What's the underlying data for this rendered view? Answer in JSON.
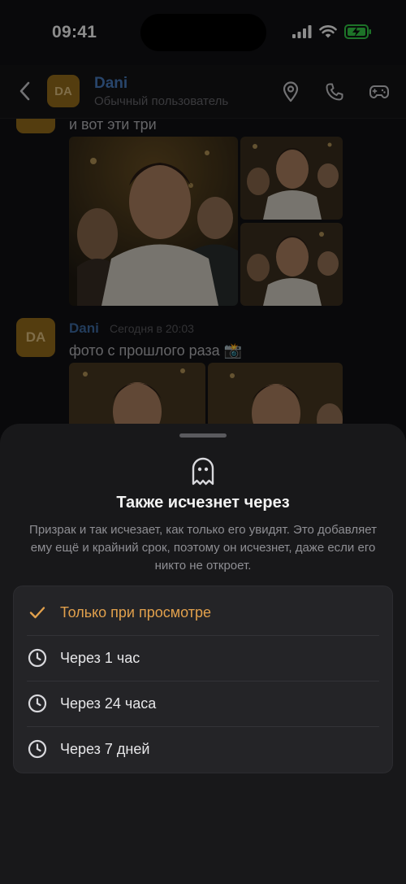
{
  "status_bar": {
    "time": "09:41"
  },
  "header": {
    "avatar_initials": "DA",
    "name": "Dani",
    "status": "Обычный пользователь",
    "icons": [
      "chevron-left-icon",
      "location-pin-icon",
      "phone-icon",
      "gamepad-icon"
    ]
  },
  "messages": {
    "first_text": "и вот эти три",
    "second": {
      "avatar_initials": "DA",
      "name": "Dani",
      "time": "Сегодня в 20:03",
      "text": "фото с прошлого раза 📸"
    }
  },
  "sheet": {
    "title": "Также исчезнет через",
    "description": "Призрак и так исчезает, как только его увидят. Это добавляет ему ещё и крайний срок, поэтому он исчезнет, даже если его никто не откроет.",
    "options": [
      {
        "label": "Только при просмотре",
        "icon": "checkmark-icon",
        "selected": true
      },
      {
        "label": "Через 1 час",
        "icon": "clock-icon",
        "selected": false
      },
      {
        "label": "Через 24 часа",
        "icon": "clock-icon",
        "selected": false
      },
      {
        "label": "Через 7 дней",
        "icon": "clock-icon",
        "selected": false
      }
    ]
  },
  "colors": {
    "accent": "#e1a04c",
    "name_blue": "#4a7fc4",
    "avatar_bg": "#9a6f1c",
    "sheet_bg": "#18181a",
    "battery_green": "#35d24a"
  }
}
